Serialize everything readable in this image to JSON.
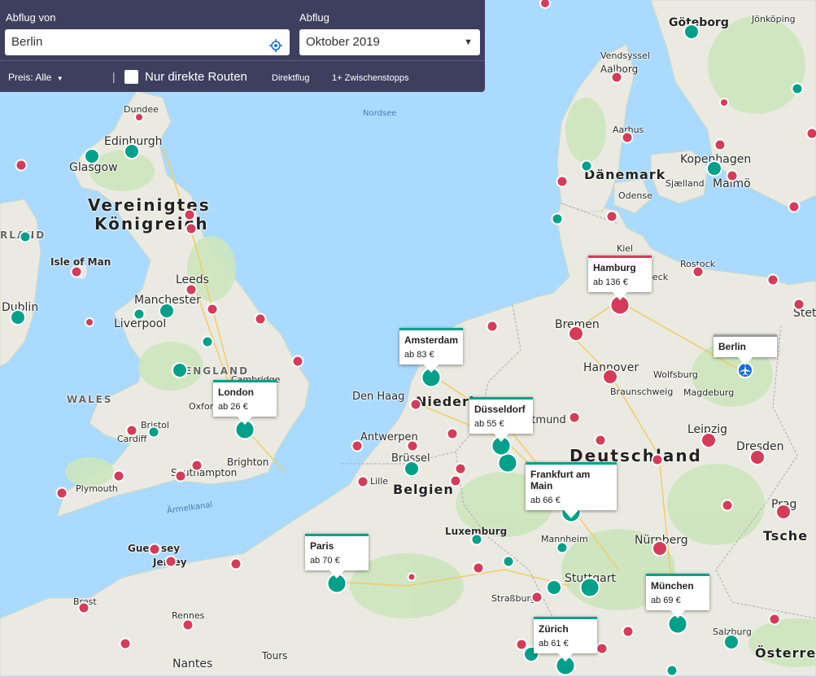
{
  "search": {
    "from_label": "Abflug von",
    "from_value": "Berlin",
    "date_label": "Abflug",
    "date_value": "Oktober 2019",
    "price_filter": "Preis: Alle",
    "separator": "|",
    "direct_routes_label": "Nur direkte Routen",
    "direct_flight_label": "Direktflug",
    "stopover_label": "1+ Zwischenstopps"
  },
  "icons": {
    "locate": "crosshair-locate-icon",
    "dropdown": "caret-down-icon",
    "plane": "plane-icon"
  },
  "colors": {
    "panel": "#3e3f5e",
    "red_marker": "#d63c5a",
    "teal_marker": "#00a08a",
    "origin_marker": "#1a6ce0",
    "water": "#aadaff",
    "land": "#eaeae2"
  },
  "destinations": [
    {
      "city": "London",
      "price": "ab 26 €",
      "style": "tl"
    },
    {
      "city": "Amsterdam",
      "price": "ab 83 €",
      "style": "tl"
    },
    {
      "city": "Düsseldorf",
      "price": "ab 55 €",
      "style": "tl"
    },
    {
      "city": "Frankfurt am Main",
      "price": "ab 66 €",
      "style": "tl"
    },
    {
      "city": "Paris",
      "price": "ab 70 €",
      "style": "tl"
    },
    {
      "city": "München",
      "price": "ab 69 €",
      "style": "tl"
    },
    {
      "city": "Zürich",
      "price": "ab 61 €",
      "style": "tl"
    },
    {
      "city": "Hamburg",
      "price": "ab 136 €",
      "style": "rd"
    },
    {
      "city": "Berlin",
      "style": "gr"
    }
  ],
  "map_labels": {
    "countries": [
      "Vereinigtes",
      "Königreich",
      "Dänemark",
      "Deutschland",
      "Belgien",
      "Niederl",
      "Tsche",
      "Österreich",
      "RLAND"
    ],
    "regions": [
      "WALES",
      "ENGLAND"
    ],
    "seas": [
      "Nordsee",
      "Ärmelkanal"
    ],
    "cities": [
      "Göteborg",
      "Jönköping",
      "Vendsyssel",
      "Aalborg",
      "Aarhus",
      "Kopenhagen",
      "Malmö",
      "Sjælland",
      "Odense",
      "Kiel",
      "Rostock",
      "Lübeck",
      "Stett",
      "Dundee",
      "Edinburgh",
      "Glasgow",
      "Isle of Man",
      "Dublin",
      "Leeds",
      "Manchester",
      "Liverpool",
      "Cambridge",
      "Oxford",
      "Bristol",
      "Cardiff",
      "Brighton",
      "Southampton",
      "Plymouth",
      "Guernsey",
      "Jersey",
      "Brest",
      "Rennes",
      "Nantes",
      "Tours",
      "Bremen",
      "Hannover",
      "Wolfsburg",
      "Braunschweig",
      "Magdeburg",
      "Den Haag",
      "Dortmund",
      "Antwerpen",
      "Brüssel",
      "Lille",
      "Luxemburg",
      "Mannheim",
      "Stuttgart",
      "Straßburg",
      "Nürnberg",
      "Leipzig",
      "Dresden",
      "Prag",
      "Salzburg"
    ]
  }
}
